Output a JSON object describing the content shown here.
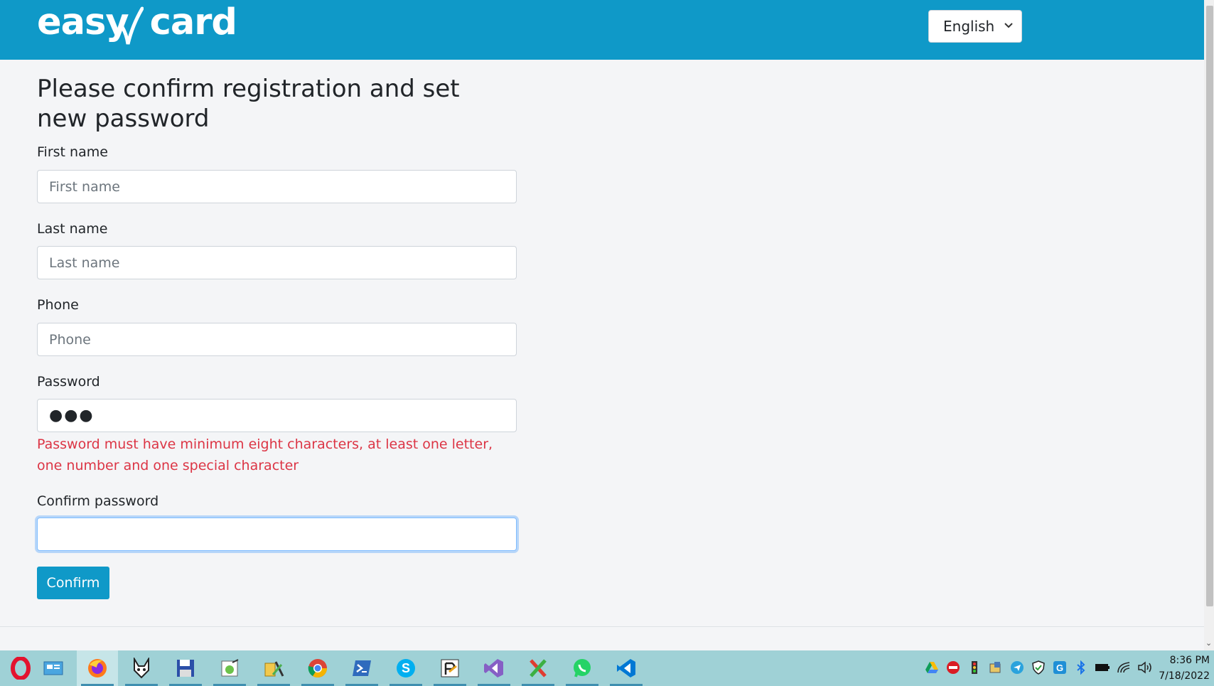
{
  "header": {
    "logo_text_1": "easy",
    "logo_text_2": "card",
    "language_selected": "English"
  },
  "form": {
    "title": "Please confirm registration and set new password",
    "first_name": {
      "label": "First name",
      "placeholder": "First name"
    },
    "last_name": {
      "label": "Last name",
      "placeholder": "Last name"
    },
    "phone": {
      "label": "Phone",
      "placeholder": "Phone"
    },
    "password": {
      "label": "Password",
      "value": "●●●"
    },
    "password_error": "Password must have minimum eight characters, at least one letter, one number and one special character",
    "confirm_password": {
      "label": "Confirm password"
    },
    "confirm_button": "Confirm"
  },
  "taskbar": {
    "apps": [
      "opera-icon",
      "control-panel-icon",
      "firefox-icon",
      "fox-app-icon",
      "floppy-save-icon",
      "notepad-frog-icon",
      "tools-icon",
      "chrome-icon",
      "powershell-icon",
      "skype-icon",
      "paint-icon",
      "visual-studio-icon",
      "x-app-icon",
      "whatsapp-icon",
      "vscode-icon"
    ],
    "time": "8:36 PM",
    "date": "7/18/2022"
  },
  "colors": {
    "brand": "#0f99c8",
    "error": "#dc3545",
    "taskbar": "#9fd1d6"
  }
}
